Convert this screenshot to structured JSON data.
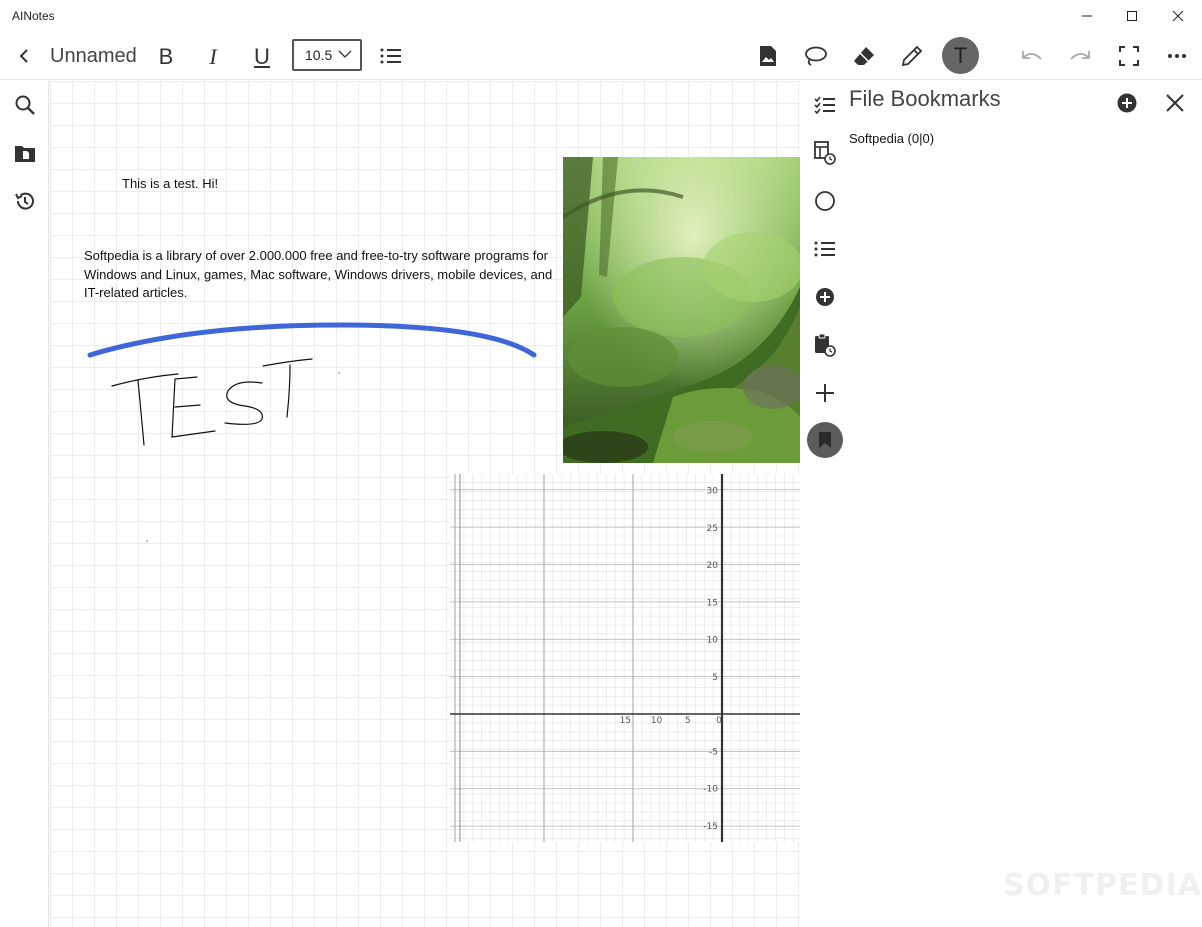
{
  "window": {
    "title": "AINotes"
  },
  "toolbar": {
    "note_title": "Unnamed",
    "bold_label": "B",
    "italic_label": "I",
    "underline_label": "U",
    "font_size": "10.5",
    "avatar_letter": "T",
    "icons": [
      "back-icon",
      "bullet-list-icon",
      "insert-image-icon",
      "lasso-icon",
      "eraser-icon",
      "pen-icon",
      "undo-icon",
      "redo-icon",
      "fullscreen-icon",
      "more-icon"
    ]
  },
  "leftnav": {
    "icons": [
      "search-icon",
      "file-icon",
      "history-icon"
    ]
  },
  "canvas": {
    "text1": "This is a test. Hi!",
    "text2": "Softpedia is a library of over 2.000.000 free and free-to-try software programs for Windows and Linux, games, Mac software, Windows drivers, mobile devices, and IT-related articles.",
    "ink_color": "#3f66d8",
    "graph": {
      "x_labels": [
        "15",
        "10",
        "5",
        "0"
      ],
      "y_labels": [
        "30",
        "25",
        "20",
        "15",
        "10",
        "5",
        "-5",
        "-10",
        "-15"
      ]
    }
  },
  "sidestrip": {
    "icons": [
      "checklist-icon",
      "table-history-icon",
      "circle-icon",
      "list-icon",
      "add-circle-icon",
      "clipboard-history-icon",
      "plus-icon",
      "bookmark-icon"
    ]
  },
  "panel": {
    "title": "File Bookmarks",
    "items": [
      {
        "label": "Softpedia (0|0)"
      }
    ]
  },
  "watermark": "SOFTPEDIA"
}
